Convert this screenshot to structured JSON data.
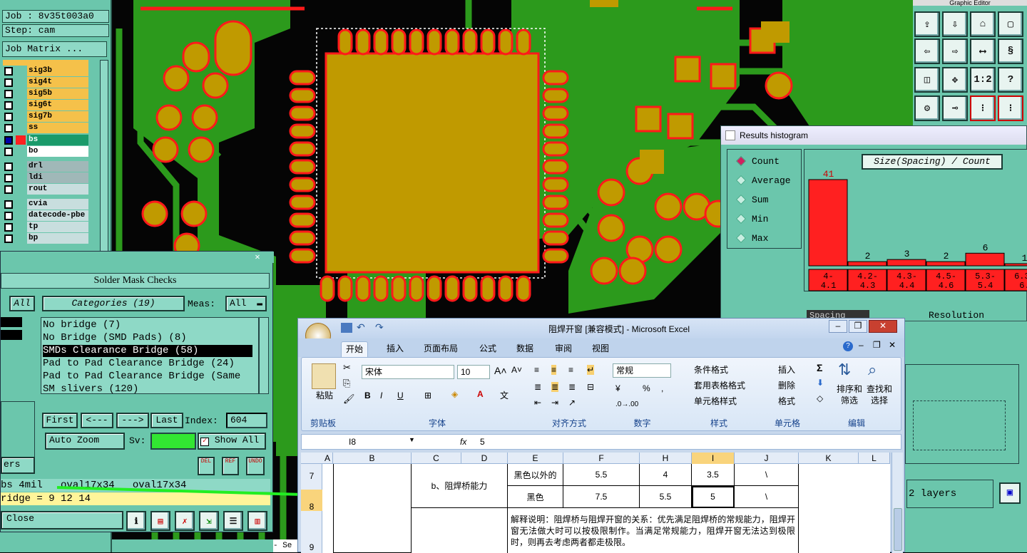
{
  "job": {
    "job_label": "Job : 8v35t003a0",
    "step_label": "Step: cam",
    "matrix_btn": "Job Matrix ..."
  },
  "layers": [
    {
      "name": "sig3b",
      "color": "#f5c14a",
      "sel": false
    },
    {
      "name": "sig4t",
      "color": "#f5c14a",
      "sel": false
    },
    {
      "name": "sig5b",
      "color": "#f5c14a",
      "sel": false
    },
    {
      "name": "sig6t",
      "color": "#f5c14a",
      "sel": false
    },
    {
      "name": "sig7b",
      "color": "#f5c14a",
      "sel": false
    },
    {
      "name": "ss",
      "color": "#f5c14a",
      "sel": false
    },
    {
      "name": "bs",
      "color": "#1a9a6a",
      "sel": true
    },
    {
      "name": "bo",
      "color": "#ffffff",
      "sel": false
    },
    {
      "name": "drl",
      "color": "#a0b8b8",
      "sel": false
    },
    {
      "name": "ldi",
      "color": "#a0b8b8",
      "sel": false
    },
    {
      "name": "rout",
      "color": "#c8dede",
      "sel": false
    },
    {
      "name": "cvia",
      "color": "#c8dede",
      "sel": false
    },
    {
      "name": "datecode-pbe",
      "color": "#c8dede",
      "sel": false
    },
    {
      "name": "tp",
      "color": "#c8dede",
      "sel": false
    },
    {
      "name": "bp",
      "color": "#c8dede",
      "sel": false
    }
  ],
  "toolbar_title": "Graphic Editor",
  "histogram": {
    "window_title": "Results histogram",
    "options": [
      "Count",
      "Average",
      "Sum",
      "Min",
      "Max"
    ],
    "selected": "Count",
    "chart_title": "Size(Spacing) / Count",
    "resolution_label": "Resolution",
    "spacing_label": "Spacing"
  },
  "chart_data": {
    "type": "bar",
    "title": "Size(Spacing) / Count",
    "categories": [
      "4-4.1",
      "4.2-4.3",
      "4.3-4.4",
      "4.5-4.6",
      "5.3-5.4",
      "6.3-6."
    ],
    "values": [
      41,
      2,
      3,
      2,
      6,
      1
    ],
    "value_labels": [
      "41",
      "2",
      "3",
      "2",
      "6",
      "1"
    ],
    "bar_color": "#ff2020"
  },
  "solder": {
    "window_title": "Solder Mask Checks",
    "all_btn": "All",
    "categories_label": "Categories (19)",
    "meas_label": "Meas:",
    "meas_value": "All",
    "items": [
      "No bridge (7)",
      "No Bridge (SMD Pads) (8)",
      "SMDs Clearance Bridge (58)",
      "Pad to Pad Clearance Bridge (24)",
      "Pad to Pad Clearance Bridge (Same",
      "SM slivers (120)"
    ],
    "selected_index": 2,
    "first": "First",
    "prev": "<---",
    "next": "--->",
    "last": "Last",
    "index_label": "Index:",
    "index_value": "604",
    "autozoom": "Auto Zoom",
    "sv_label": "Sv:",
    "show_all": "Show All",
    "ers": "ers",
    "del": "DEL",
    "ref": "REF",
    "undo": "UNDO",
    "status1": "bs 4mil   oval17x34   oval17x34",
    "status2": "ridge = 9 12 14",
    "close": "Close"
  },
  "layers_label": "2 layers",
  "sel_partial": "- Se",
  "excel": {
    "title": "阻焊开窗 [兼容模式] - Microsoft Excel",
    "tabs": [
      "开始",
      "插入",
      "页面布局",
      "公式",
      "数据",
      "审阅",
      "视图"
    ],
    "font_name": "宋体",
    "font_size": "10",
    "number_format": "常规",
    "paste": "粘贴",
    "groups": [
      "剪贴板",
      "字体",
      "对齐方式",
      "数字",
      "样式",
      "单元格",
      "编辑"
    ],
    "style_items": [
      "条件格式",
      "套用表格格式",
      "单元格样式"
    ],
    "cell_items": [
      "插入",
      "删除",
      "格式"
    ],
    "edit_items": [
      "排序和筛选",
      "查找和选择"
    ],
    "name_box": "I8",
    "fx": "fx",
    "formula": "5",
    "columns": [
      "A",
      "B",
      "C",
      "D",
      "E",
      "F",
      "H",
      "I",
      "J",
      "K",
      "L"
    ],
    "rows": [
      "7",
      "8",
      "9"
    ],
    "cell_c": "b、阻焊桥能力",
    "r7": [
      "黑色以外的",
      "5.5",
      "4",
      "3.5",
      "\\"
    ],
    "r8": [
      "黑色",
      "7.5",
      "5.5",
      "5",
      "\\"
    ],
    "note": "解释说明：阻焊桥与阻焊开窗的关系：优先满足阻焊桥的常规能力，阻焊开窗无法做大时可以按极限制作。当满足常规能力，阻焊开窗无法达到极限时，则再去考虑两者都走极限。"
  }
}
